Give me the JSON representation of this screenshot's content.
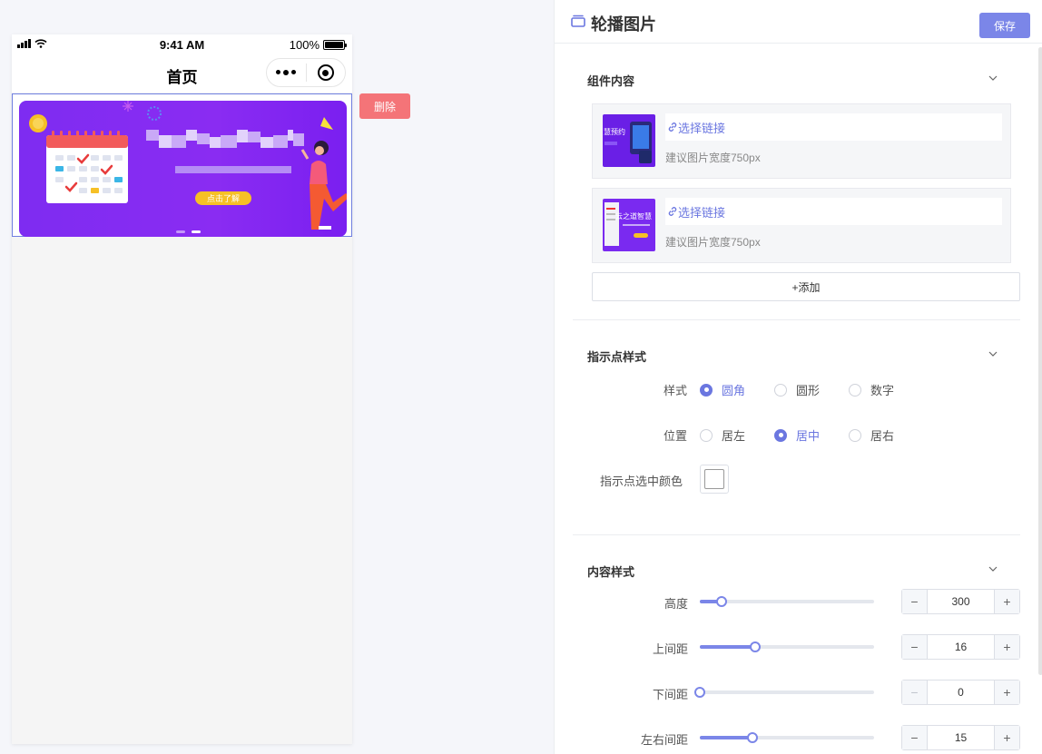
{
  "phone": {
    "status_time": "9:41 AM",
    "battery_text": "100%",
    "nav_title": "首页",
    "banner": {
      "button_text": "点击了解",
      "dots_total": 2,
      "dot_active": 2
    }
  },
  "canvas_actions": {
    "delete_label": "删除"
  },
  "panel": {
    "title": "轮播图片",
    "save_label": "保存",
    "content_section": {
      "title": "组件内容",
      "items": [
        {
          "link_label": "选择链接",
          "hint": "建议图片宽度750px",
          "thumb_text": "慧预约"
        },
        {
          "link_label": "选择链接",
          "hint": "建议图片宽度750px",
          "thumb_text": "云之道智慧"
        }
      ],
      "add_label": "+添加"
    },
    "indicator_section": {
      "title": "指示点样式",
      "style_label": "样式",
      "style_options": [
        "圆角",
        "圆形",
        "数字"
      ],
      "style_selected": "圆角",
      "position_label": "位置",
      "position_options": [
        "居左",
        "居中",
        "居右"
      ],
      "position_selected": "居中",
      "color_label": "指示点选中颜色",
      "color_value": "#ffffff"
    },
    "content_style_section": {
      "title": "内容样式",
      "rows": [
        {
          "label": "高度",
          "value": "300",
          "fraction": 0.125,
          "minus_disabled": false
        },
        {
          "label": "上间距",
          "value": "16",
          "fraction": 0.32,
          "minus_disabled": false
        },
        {
          "label": "下间距",
          "value": "0",
          "fraction": 0.0,
          "minus_disabled": true
        },
        {
          "label": "左右间距",
          "value": "15",
          "fraction": 0.3,
          "minus_disabled": false
        }
      ]
    }
  },
  "colors": {
    "accent": "#7b86e8",
    "danger": "#f47478",
    "banner_purple": "#8a2cf2"
  }
}
